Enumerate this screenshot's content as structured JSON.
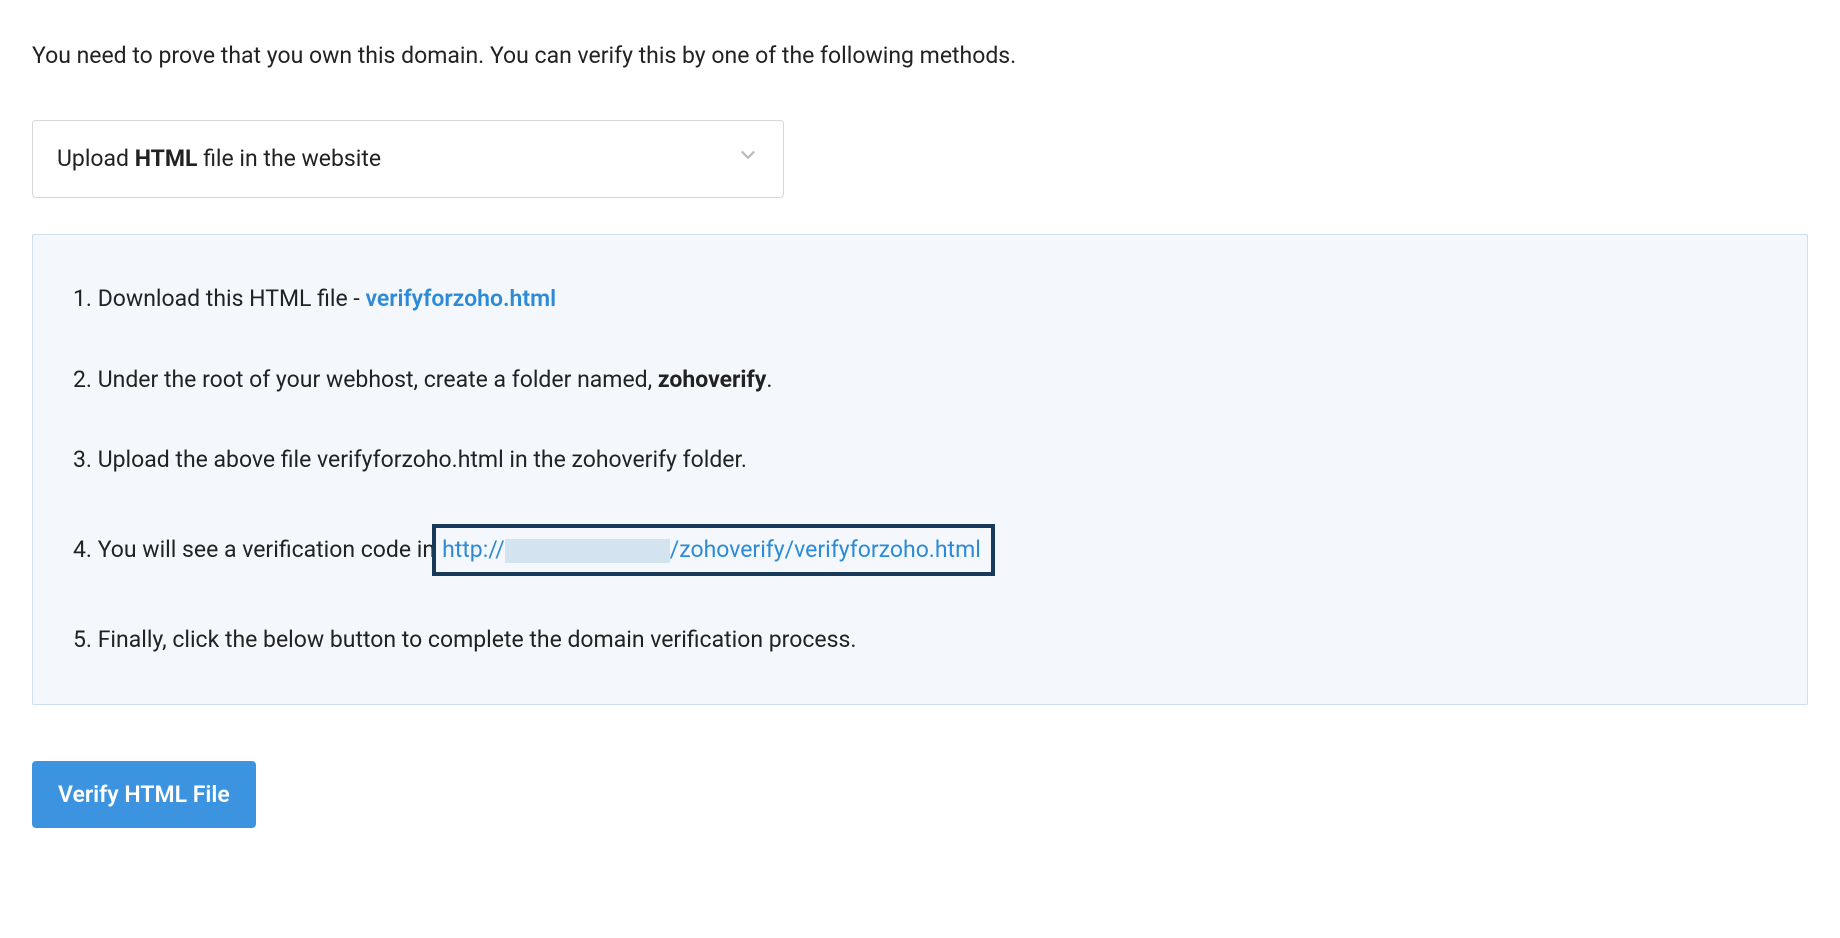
{
  "intro": "You need to prove that you own this domain. You can verify this by one of the following methods.",
  "dropdown": {
    "prefix": "Upload ",
    "bold": "HTML",
    "suffix": " file in the website"
  },
  "steps": {
    "one": {
      "num": "1.",
      "text": " Download this HTML file - ",
      "link": "verifyforzoho.html"
    },
    "two": {
      "num": "2.",
      "text": " Under the root of your webhost, create a folder named, ",
      "bold": "zohoverify",
      "suffix": "."
    },
    "three": {
      "num": "3.",
      "text": " Upload the above file verifyforzoho.html in the zohoverify folder."
    },
    "four": {
      "num": "4.",
      "text": " You will see a verification code in",
      "url_prefix": " http://",
      "url_suffix": "/zohoverify/verifyforzoho.html"
    },
    "five": {
      "num": "5.",
      "text": " Finally, click the below button to complete the domain verification process."
    }
  },
  "button": {
    "label": "Verify HTML File"
  }
}
